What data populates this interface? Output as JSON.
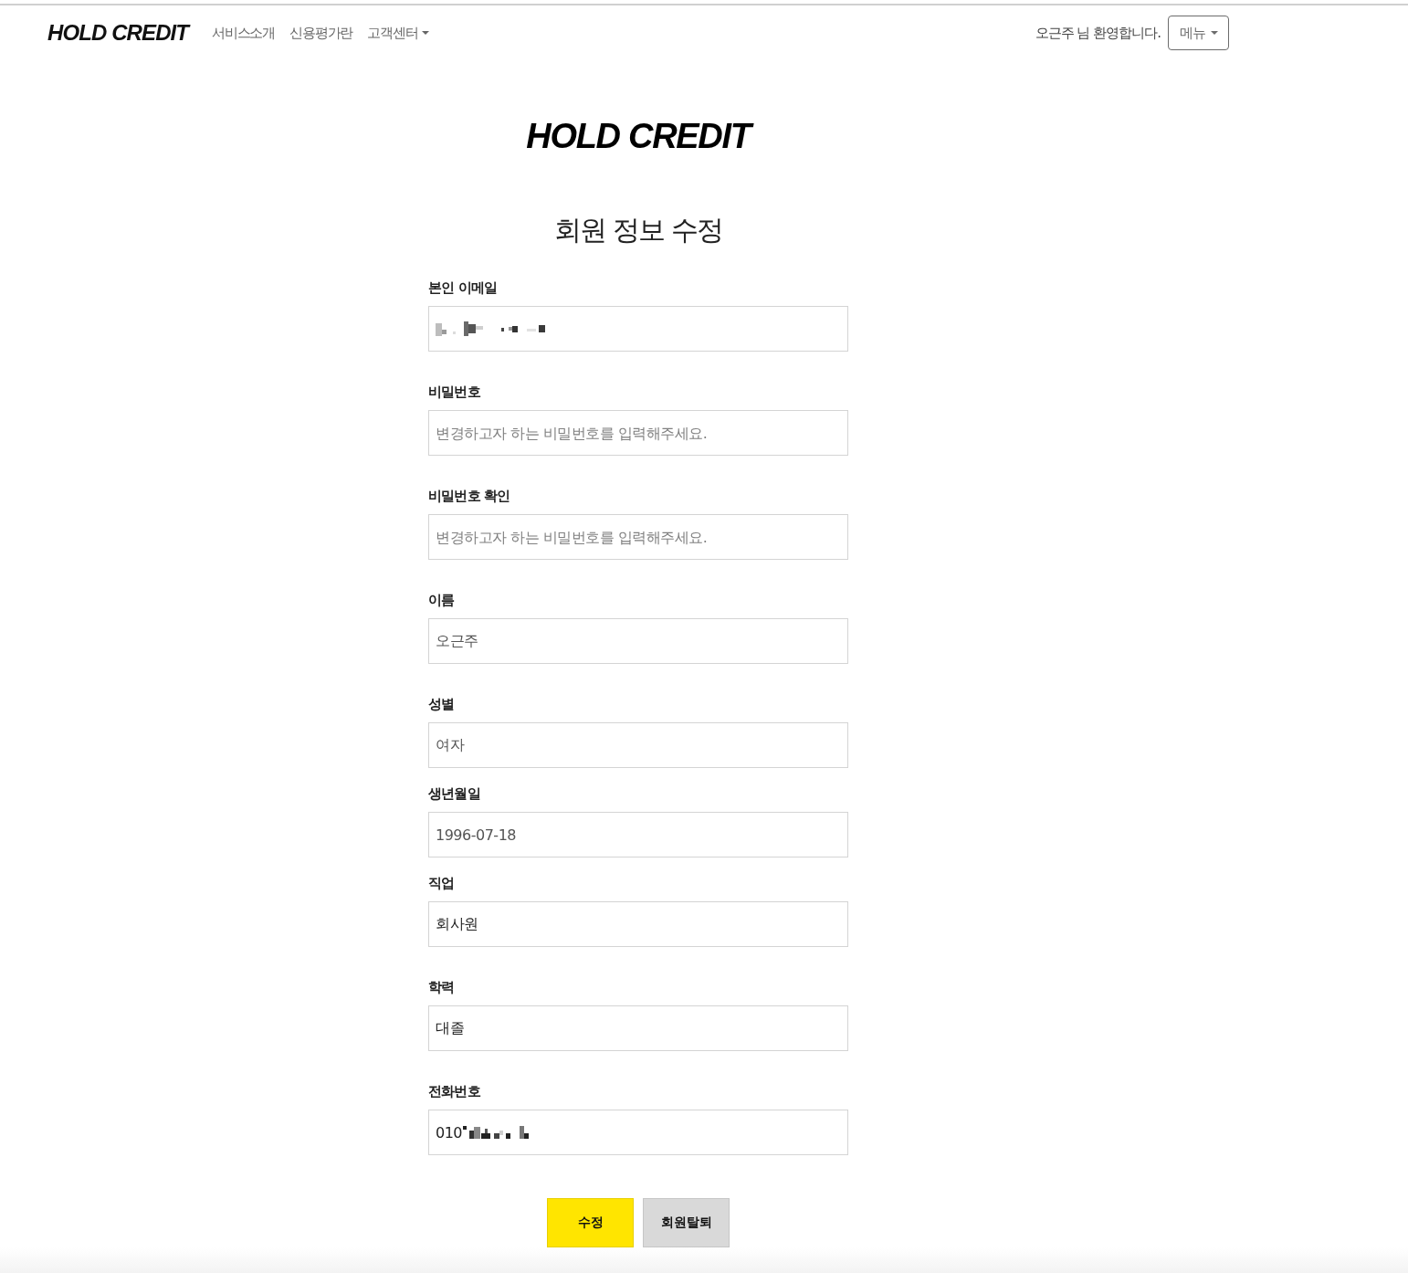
{
  "nav": {
    "brand": "HOLD CREDIT",
    "links": [
      {
        "label": "서비스소개",
        "dropdown": false
      },
      {
        "label": "신용평가란",
        "dropdown": false
      },
      {
        "label": "고객센터",
        "dropdown": true
      }
    ],
    "welcome": "오근주 님 환영합니다.",
    "menu_button": {
      "label": "메뉴",
      "dropdown": true
    }
  },
  "logo": "HOLD CREDIT",
  "title": "회원 정보 수정",
  "fields": [
    {
      "label": "본인 이메일",
      "redacted": true
    },
    {
      "label": "비밀번호",
      "placeholder": "변경하고자 하는 비밀번호를 입력해주세요.",
      "redacted": false
    },
    {
      "label": "비밀번호 확인",
      "placeholder": "변경하고자 하는 비밀번호를 입력해주세요.",
      "redacted": false
    },
    {
      "label": "이름",
      "value": "오근주",
      "readonly": true,
      "redacted": false
    },
    {
      "label": "성별",
      "value": "여자",
      "readonly": true,
      "redacted": false
    },
    {
      "label": "생년월일",
      "value": "1996-07-18",
      "readonly": true,
      "redacted": false
    },
    {
      "label": "직업",
      "value": "회사원",
      "readonly": false,
      "redacted": false
    },
    {
      "label": "학력",
      "value": "대졸",
      "readonly": false,
      "redacted": false
    },
    {
      "label": "전화번호",
      "value": "010",
      "readonly": false,
      "redacted": true
    }
  ],
  "buttons": [
    {
      "label": "수정",
      "kind": "primary"
    },
    {
      "label": "회원탈퇴",
      "kind": "secondary"
    }
  ]
}
